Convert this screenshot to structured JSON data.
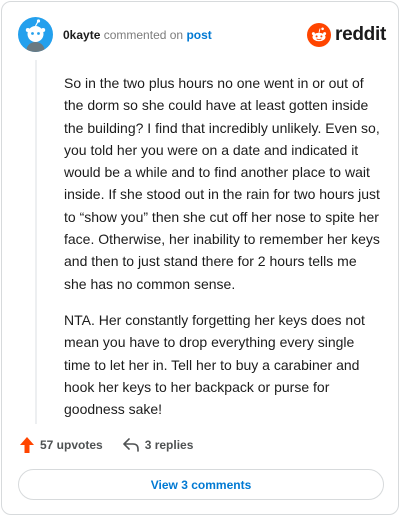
{
  "header": {
    "username": "0kayte",
    "action_text": "commented on",
    "post_link": "post",
    "brand_name": "reddit",
    "brand_color": "#ff4500"
  },
  "comment": {
    "paragraphs": [
      "So in the two plus hours no one went in or out of the dorm so she could have at least gotten inside the building? I find that incredibly unlikely. Even so, you told her you were on a date and indicated it would be a while and to find another place to wait inside. If she stood out in the rain for two hours just to “show you” then she cut off her nose to spite her face. Otherwise, her inability to remember her keys and then to just stand there for 2 hours tells me she has no common sense.",
      "NTA. Her constantly forgetting her keys does not mean you have to drop everything every single time to let her in. Tell her to buy a carabiner and hook her keys to her backpack or purse for goodness sake!"
    ]
  },
  "actions": {
    "upvotes": "57 upvotes",
    "replies": "3 replies",
    "upvote_icon": "upvote-arrow-icon",
    "reply_icon": "reply-arrow-icon"
  },
  "footer": {
    "view_comments": "View 3 comments"
  }
}
